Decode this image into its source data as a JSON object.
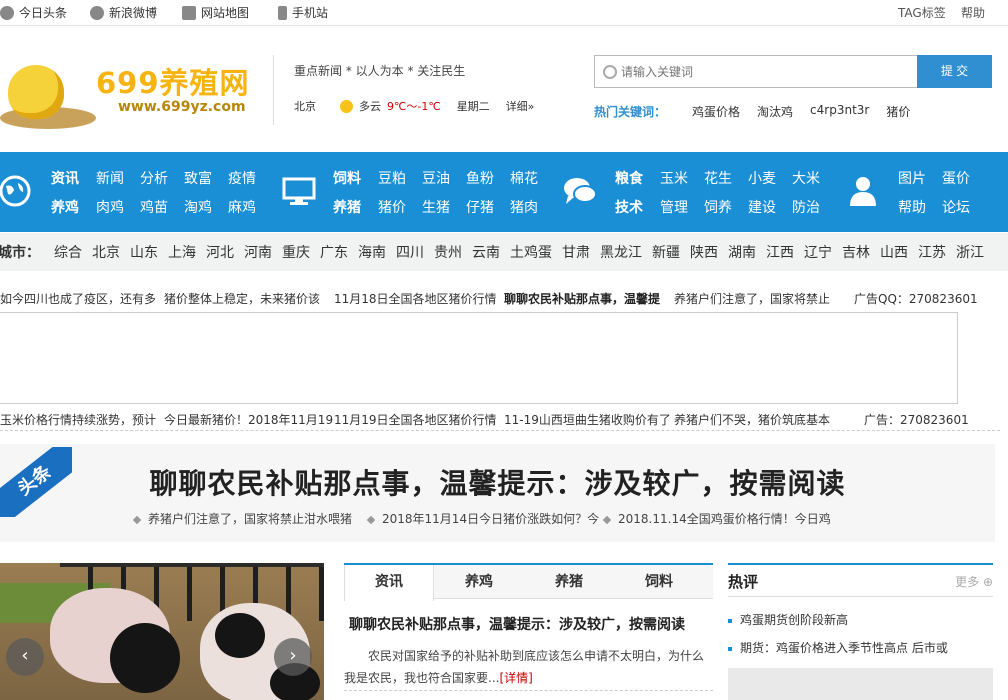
{
  "topbar": {
    "links": [
      "今日头条",
      "新浪微博",
      "网站地图",
      "手机站"
    ],
    "right": [
      "TAG标签",
      "帮助"
    ]
  },
  "header": {
    "logo_text": "699养殖网",
    "logo_url_text": "www.699yz.com",
    "slogan": "重点新闻 * 以人为本 * 关注民生",
    "weather": {
      "city": "北京",
      "condition": "多云",
      "temp": "9℃～-1℃",
      "weekday": "星期二",
      "detail": "详细»"
    },
    "search": {
      "placeholder": "请输入关键词",
      "button": "提 交"
    },
    "hot_keywords_label": "热门关键词：",
    "hot_keywords": [
      "鸡蛋价格",
      "淘汰鸡",
      "c4rp3nt3r",
      "猪价"
    ]
  },
  "nav": {
    "group1": {
      "row1": [
        "资讯",
        "新闻",
        "分析",
        "致富",
        "疫情"
      ],
      "row2": [
        "养鸡",
        "肉鸡",
        "鸡苗",
        "淘鸡",
        "麻鸡"
      ]
    },
    "group2": {
      "row1": [
        "饲料",
        "豆粕",
        "豆油",
        "鱼粉",
        "棉花"
      ],
      "row2": [
        "养猪",
        "猪价",
        "生猪",
        "仔猪",
        "猪肉"
      ]
    },
    "group3": {
      "row1": [
        "粮食",
        "玉米",
        "花生",
        "小麦",
        "大米"
      ],
      "row2": [
        "技术",
        "管理",
        "饲养",
        "建设",
        "防治"
      ]
    },
    "group4": {
      "row1": [
        "图片",
        "蛋价"
      ],
      "row2": [
        "帮助",
        "论坛"
      ]
    }
  },
  "cities": {
    "label": "城市：",
    "items": [
      "综合",
      "北京",
      "山东",
      "上海",
      "河北",
      "河南",
      "重庆",
      "广东",
      "海南",
      "四川",
      "贵州",
      "云南",
      "土鸡蛋",
      "甘肃",
      "黑龙江",
      "新疆",
      "陕西",
      "湖南",
      "江西",
      "辽宁",
      "吉林",
      "山西",
      "江苏",
      "浙江"
    ]
  },
  "ticker1": {
    "items": [
      "如今四川也成了疫区，还有多",
      "猪价整体上稳定，未来猪价该",
      "11月18日全国各地区猪价行情"
    ],
    "bold": "聊聊农民补贴那点事，温馨提",
    "after": "养猪户们注意了，国家将禁止",
    "ad": "广告QQ：270823601"
  },
  "ticker2": {
    "items": [
      "玉米价格行情持续涨势，预计",
      "今日最新猪价！2018年11月19",
      "11月19日全国各地区猪价行情",
      "11-19山西垣曲生猪收购价有了",
      "养猪户们不哭，猪价筑底基本"
    ],
    "ad": "广告：270823601"
  },
  "headline": {
    "badge": "头条",
    "title": "聊聊农民补贴那点事，温馨提示：涉及较广，按需阅读",
    "subs": [
      "养猪户们注意了，国家将禁止泔水喂猪",
      "2018年11月14日今日猪价涨跌如何？今",
      "2018.11.14全国鸡蛋价格行情！今日鸡"
    ]
  },
  "slider": {
    "prev": "‹",
    "next": "›"
  },
  "tabs": [
    "资讯",
    "养鸡",
    "养猪",
    "饲料"
  ],
  "news": {
    "title": "聊聊农民补贴那点事，温馨提示：涉及较广，按需阅读",
    "body": "农民对国家给予的补贴补助到底应该怎么申请不太明白，为什么我是农民，我也符合国家要...",
    "more": "[详情]"
  },
  "commentary": {
    "title": "热评",
    "more": "更多",
    "items": [
      "鸡蛋期货创阶段新高",
      "期货：鸡蛋价格进入季节性高点 后市或"
    ]
  },
  "colors": {
    "nav_blue": "#1b8fd6",
    "logo_yellow": "#f7b312",
    "highlight_red": "#cc0000"
  }
}
